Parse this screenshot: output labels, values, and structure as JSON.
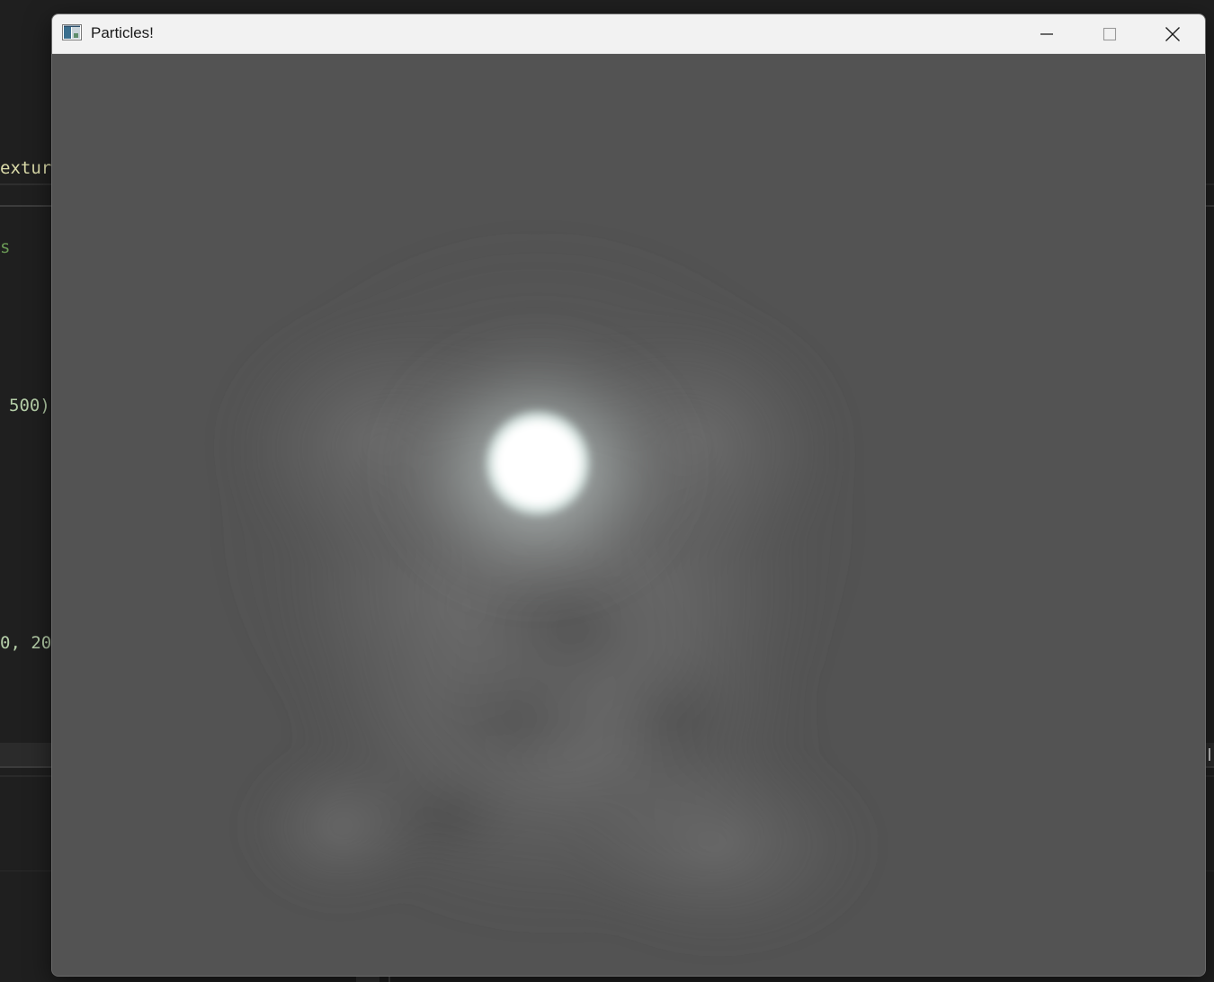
{
  "background_editor": {
    "fragments": {
      "texture": "extur",
      "s": "s",
      "n500": "500)",
      "n20": "0, 20"
    }
  },
  "window": {
    "title": "Particles!",
    "controls": {
      "minimize_icon": "minimize-icon",
      "maximize_icon": "maximize-icon",
      "close_icon": "close-icon"
    }
  },
  "scene": {
    "background_color": "#535353",
    "glow_color": "#ffffff",
    "smoke_color": "#6e6e6e"
  }
}
